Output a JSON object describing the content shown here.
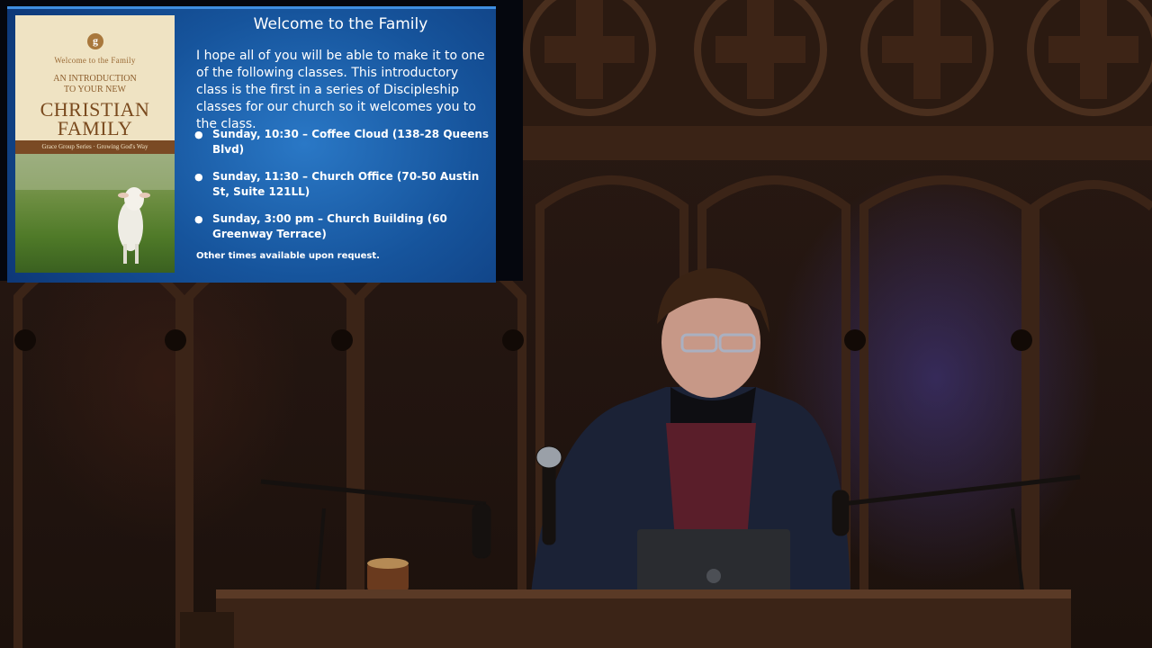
{
  "slide": {
    "title": "Welcome to the Family",
    "intro": "I hope all of you will be able to make it to one of the following classes. This introductory class is the first in a series of Discipleship classes for our church so it welcomes you to the class.",
    "classes": [
      "Sunday, 10:30 – Coffee Cloud (138-28 Queens Blvd)",
      "Sunday, 11:30 – Church Office (70-50 Austin St, Suite 121LL)",
      "Sunday, 3:00 pm – Church Building (60 Greenway Terrace)"
    ],
    "note": "Other times available upon request.",
    "bullet": "●"
  },
  "book": {
    "logo": "g",
    "welcome": "Welcome to the Family",
    "intro_line1": "AN INTRODUCTION",
    "intro_line2": "TO YOUR NEW",
    "title_line1": "CHRISTIAN",
    "title_line2": "FAMILY",
    "series": "Grace Group Series · Growing God's Way"
  },
  "colors": {
    "slide_blue": "#16549c",
    "wood_dark": "#241611",
    "stage_light": "#4a3c96"
  }
}
